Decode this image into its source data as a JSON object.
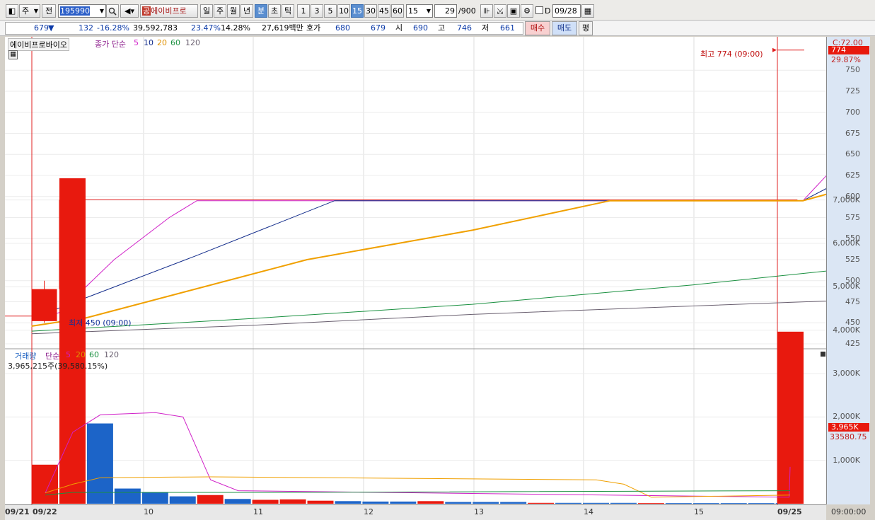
{
  "toolbar": {
    "market": "주",
    "prev": "전",
    "code": "195990",
    "stock_name": "에이비프로",
    "brand_prefix": "공",
    "periods": [
      "일",
      "주",
      "월",
      "년",
      "분",
      "초",
      "틱"
    ],
    "selected_period": "분",
    "intervals": [
      "1",
      "3",
      "5",
      "10",
      "15",
      "30",
      "45",
      "60"
    ],
    "selected_interval": "15",
    "interval_input": "15",
    "count": "29",
    "count_total": "/900",
    "checkbox_label": "D",
    "date": "09/28"
  },
  "info": {
    "price": "679",
    "change_arrow": "▼",
    "change": "132",
    "change_pct": "-16.28%",
    "volume": "39,592,783",
    "vol_pct1": "23.47%",
    "vol_pct2": "14.28%",
    "amount": "27,619백만",
    "quote_label": "호가",
    "ask": "680",
    "bid": "679",
    "open_label": "시",
    "open": "690",
    "high_label": "고",
    "high": "746",
    "low_label": "저",
    "low": "661",
    "buy_label": "매수",
    "sell_label": "매도",
    "avg_label": "평"
  },
  "price_legend": {
    "name": "에이비프로바이오",
    "type": "종가 단순",
    "ma5": "5",
    "ma10": "10",
    "ma20": "20",
    "ma60": "60",
    "ma120": "120"
  },
  "price_axis": {
    "current_label": "C:72.00",
    "current_value": "774",
    "current_pct": "29.87%",
    "ticks": [
      "750",
      "725",
      "700",
      "675",
      "650",
      "625",
      "600",
      "575",
      "550",
      "525",
      "500",
      "475",
      "450",
      "425"
    ]
  },
  "annotations": {
    "high": "최고 774 (09:00)",
    "low": "최저 450 (09:00)"
  },
  "volume_legend": {
    "name": "거래량",
    "type": "단순",
    "ma5": "5",
    "ma20": "20",
    "ma60": "60",
    "ma120": "120",
    "current": "3,965,215주(39,580.15%)"
  },
  "volume_axis": {
    "current_value": "3,965K",
    "current_sub": "33580.75",
    "ticks": [
      "7,000K",
      "6,000K",
      "5,000K",
      "4,000K",
      "3,000K",
      "2,000K",
      "1,000K"
    ]
  },
  "x_axis": {
    "labels": [
      "09/21",
      "09/22",
      "10",
      "11",
      "12",
      "13",
      "14",
      "15",
      "09/25"
    ],
    "time": "09:00:00"
  },
  "colors": {
    "up": "#e8190e",
    "down": "#1c64c8",
    "ma5": "#d020c8",
    "ma10": "#102a8a",
    "ma20": "#f0a000",
    "ma60": "#1a9040",
    "ma120": "#6a6070"
  },
  "chart_data": {
    "type": "candlestick",
    "price_ylim": [
      425,
      774
    ],
    "candles": [
      {
        "x": "09/22 09:00",
        "open": 452,
        "high": 500,
        "low": 450,
        "close": 490
      },
      {
        "x": "09/22 09:15",
        "open": 490,
        "high": 596,
        "low": 480,
        "close": 596
      }
    ],
    "flat_line_value": 596,
    "last_price": 774,
    "ma_series": [
      {
        "name": "5",
        "values": [
          [
            0,
            453
          ],
          [
            1,
            462
          ],
          [
            3,
            525
          ],
          [
            5,
            575
          ],
          [
            6,
            595
          ],
          [
            28,
            595
          ],
          [
            29,
            630
          ]
        ]
      },
      {
        "name": "10",
        "values": [
          [
            0,
            455
          ],
          [
            2,
            480
          ],
          [
            6,
            530
          ],
          [
            11,
            595
          ],
          [
            28,
            595
          ],
          [
            29,
            612
          ]
        ]
      },
      {
        "name": "20",
        "values": [
          [
            0,
            446
          ],
          [
            2,
            456
          ],
          [
            10,
            525
          ],
          [
            16,
            560
          ],
          [
            21,
            595
          ],
          [
            28,
            595
          ],
          [
            29,
            604
          ]
        ]
      },
      {
        "name": "60",
        "values": [
          [
            0,
            440
          ],
          [
            8,
            455
          ],
          [
            16,
            472
          ],
          [
            24,
            495
          ],
          [
            29,
            512
          ]
        ]
      },
      {
        "name": "120",
        "values": [
          [
            0,
            437
          ],
          [
            8,
            447
          ],
          [
            16,
            460
          ],
          [
            24,
            470
          ],
          [
            29,
            476
          ]
        ]
      }
    ],
    "volume_ylim": [
      0,
      7500
    ],
    "volume_bars": [
      {
        "x": 0,
        "value": 900,
        "dir": "up"
      },
      {
        "x": 1,
        "value": 7500,
        "dir": "up"
      },
      {
        "x": 2,
        "value": 1850,
        "dir": "down"
      },
      {
        "x": 3,
        "value": 350,
        "dir": "down"
      },
      {
        "x": 4,
        "value": 270,
        "dir": "down"
      },
      {
        "x": 5,
        "value": 170,
        "dir": "down"
      },
      {
        "x": 6,
        "value": 200,
        "dir": "up"
      },
      {
        "x": 7,
        "value": 110,
        "dir": "down"
      },
      {
        "x": 8,
        "value": 90,
        "dir": "up"
      },
      {
        "x": 9,
        "value": 100,
        "dir": "up"
      },
      {
        "x": 10,
        "value": 70,
        "dir": "up"
      },
      {
        "x": 11,
        "value": 60,
        "dir": "down"
      },
      {
        "x": 12,
        "value": 50,
        "dir": "down"
      },
      {
        "x": 13,
        "value": 50,
        "dir": "down"
      },
      {
        "x": 14,
        "value": 60,
        "dir": "up"
      },
      {
        "x": 15,
        "value": 40,
        "dir": "down"
      },
      {
        "x": 16,
        "value": 40,
        "dir": "down"
      },
      {
        "x": 17,
        "value": 40,
        "dir": "down"
      },
      {
        "x": 18,
        "value": 20,
        "dir": "up"
      },
      {
        "x": 19,
        "value": 20,
        "dir": "down"
      },
      {
        "x": 20,
        "value": 20,
        "dir": "down"
      },
      {
        "x": 21,
        "value": 20,
        "dir": "down"
      },
      {
        "x": 22,
        "value": 15,
        "dir": "up"
      },
      {
        "x": 23,
        "value": 15,
        "dir": "down"
      },
      {
        "x": 24,
        "value": 15,
        "dir": "down"
      },
      {
        "x": 25,
        "value": 15,
        "dir": "down"
      },
      {
        "x": 26,
        "value": 15,
        "dir": "down"
      },
      {
        "x": 27,
        "value": 15,
        "dir": "down"
      },
      {
        "x": 28,
        "value": 3965,
        "dir": "up"
      }
    ],
    "volume_ma": [
      {
        "name": "5",
        "values": [
          [
            0,
            250
          ],
          [
            1,
            1650
          ],
          [
            2,
            2050
          ],
          [
            4,
            2100
          ],
          [
            5,
            2000
          ],
          [
            6,
            550
          ],
          [
            7,
            300
          ],
          [
            27,
            150
          ],
          [
            28,
            850
          ]
        ]
      },
      {
        "name": "20",
        "values": [
          [
            0,
            250
          ],
          [
            1,
            450
          ],
          [
            2,
            600
          ],
          [
            6,
            620
          ],
          [
            20,
            550
          ],
          [
            21,
            450
          ],
          [
            22,
            150
          ],
          [
            28,
            200
          ]
        ]
      },
      {
        "name": "60",
        "values": [
          [
            0,
            200
          ],
          [
            1,
            260
          ],
          [
            8,
            260
          ],
          [
            28,
            300
          ]
        ]
      }
    ]
  }
}
